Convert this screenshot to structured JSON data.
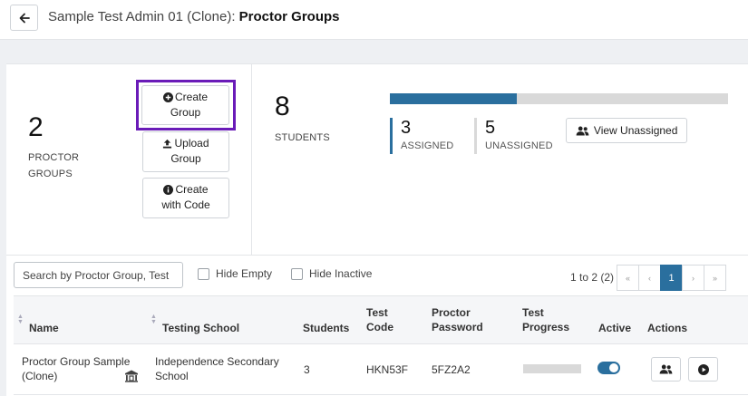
{
  "header": {
    "title_prefix": "Sample Test Admin 01 (Clone): ",
    "title_main": "Proctor Groups"
  },
  "summary": {
    "proctor_groups_count": "2",
    "proctor_groups_label_line1": "PROCTOR",
    "proctor_groups_label_line2": "GROUPS",
    "create_group_line1": "Create",
    "create_group_line2": "Group",
    "upload_group_line1": "Upload",
    "upload_group_line2": "Group",
    "create_code_line1": "Create",
    "create_code_line2": "with Code",
    "students_count": "8",
    "students_label": "STUDENTS",
    "assigned_count": "3",
    "assigned_label": "ASSIGNED",
    "unassigned_count": "5",
    "unassigned_label": "UNASSIGNED",
    "assigned_fraction": 0.375,
    "view_unassigned_label": "View Unassigned"
  },
  "toolbar": {
    "search_placeholder": "Search by Proctor Group, Test",
    "hide_empty_label": "Hide Empty",
    "hide_inactive_label": "Hide Inactive",
    "pager_info": "1 to 2 (2)",
    "pager": {
      "first": "«",
      "prev": "‹",
      "current": "1",
      "next": "›",
      "last": "»"
    }
  },
  "table": {
    "headers": {
      "name": "Name",
      "school": "Testing School",
      "students": "Students",
      "test_code_1": "Test",
      "test_code_2": "Code",
      "proctor_pw_1": "Proctor",
      "proctor_pw_2": "Password",
      "progress_1": "Test",
      "progress_2": "Progress",
      "active": "Active",
      "actions": "Actions"
    },
    "rows": [
      {
        "name_line1": "Proctor Group Sample",
        "name_line2": "(Clone)",
        "school_line1": "Independence Secondary",
        "school_line2": "School",
        "students": "3",
        "test_code": "HKN53F",
        "proctor_password": "5FZ2A2",
        "progress": 0,
        "active": true
      }
    ]
  },
  "colors": {
    "accent": "#2a6f9e",
    "highlight": "#6a1bb8"
  }
}
